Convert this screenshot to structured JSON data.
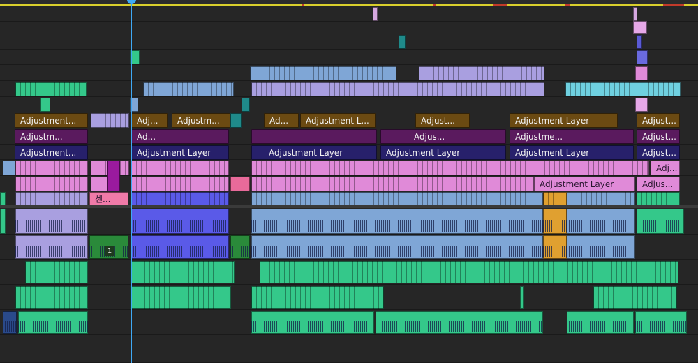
{
  "app": {
    "panel": "timeline",
    "adjustment_label": "Adjustment Layer"
  },
  "colors": {
    "background": "#232323",
    "playhead": "#3fa9f5",
    "work_area": "#d9cf2c",
    "adjustment_brown": "#6b4a12",
    "adjustment_purple": "#5a1a5e",
    "adjustment_navy": "#27206b",
    "pink_video": "#e08ad8",
    "lavender": "#a99fe0",
    "steel_blue": "#7fa6d6",
    "green_audio": "#34c88a",
    "orange": "#e0a030",
    "teal": "#1f8a8a"
  },
  "clips": {
    "v12_a": "",
    "v12_b": "",
    "v11_a": "",
    "v10_a": "",
    "v10_b": "",
    "v9_a": "",
    "v9_b": "",
    "v8_a": "",
    "v8_b": "",
    "v8_c": "",
    "v7_a": "",
    "v7_b": "",
    "v7_c": "",
    "v6_a": "Adjustment...",
    "v6_b": "Adj...",
    "v6_c": "Adjustm...",
    "v6_d": "Ad...",
    "v6_e": "Adjustment L...",
    "v6_f": "Adjust...",
    "v6_g": "Adjustment Layer",
    "v6_h": "Adjust...",
    "v5_a": "Adjustm...",
    "v5_b": "Ad...",
    "v5_c": "Adjus...",
    "v5_d": "Adjustme...",
    "v5_e": "Adjust...",
    "v4_a": "Adjustment...",
    "v4_b": "Adjustment Layer",
    "v4_c": "Adjustment Layer",
    "v4_d": "Adjustment Layer",
    "v4_e": "Adjustment Layer",
    "v4_f": "Adjust...",
    "v3_a": "Adj...",
    "v2_a": "Adjustment Layer",
    "v2_b": "Adjus...",
    "v1_a": "센...",
    "nest_badge": "1"
  }
}
